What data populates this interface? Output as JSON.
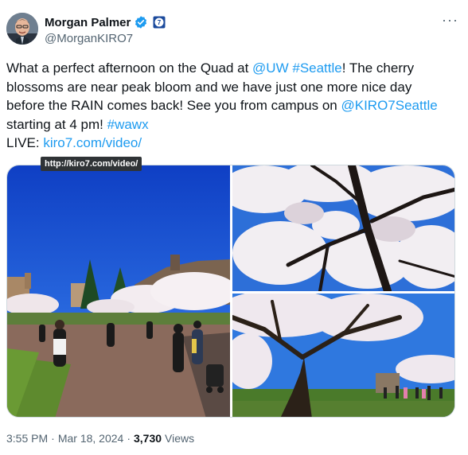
{
  "author": {
    "display_name": "Morgan Palmer",
    "handle": "@MorganKIRO7",
    "verified_icon": "verified-badge-icon",
    "affiliation_icon": "kiro7-affiliate-icon",
    "affiliation_badge_text": "7"
  },
  "more_label": "···",
  "tweet": {
    "p1": "What a perfect afternoon on the Quad at ",
    "mention_uw": "@UW",
    "gap1": " ",
    "hashtag_seattle": "#Seattle",
    "p2": "! The cherry blossoms are near peak bloom and we have just one more nice day before the RAIN comes back! See you from campus on ",
    "mention_kiro": "@KIRO7Seattle",
    "p3": " starting at 4 pm! ",
    "hashtag_wawx": "#wawx",
    "live_label": "LIVE: ",
    "link_text": "kiro7.com/video/"
  },
  "tooltip": "http://kiro7.com/video/",
  "photos": [
    {
      "name": "quad-wide-photo"
    },
    {
      "name": "blossom-branches-photo"
    },
    {
      "name": "tree-trunk-photo"
    }
  ],
  "meta": {
    "time": "3:55 PM",
    "sep1": "·",
    "date": "Mar 18, 2024",
    "sep2": "·",
    "views_count": "3,730",
    "views_label": "Views"
  },
  "colors": {
    "link": "#1d9bf0",
    "secondary": "#536471",
    "text": "#0f1419",
    "border": "#cfd9de"
  }
}
